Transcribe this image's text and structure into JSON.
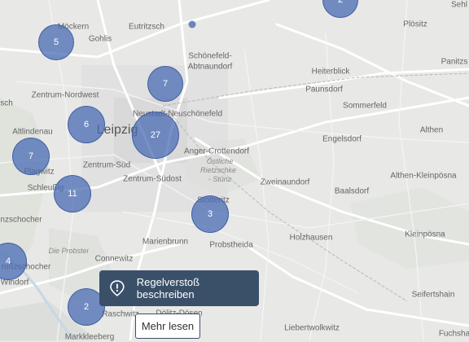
{
  "places": [
    {
      "name": "Sehl"
    },
    {
      "name": "Plösitz"
    },
    {
      "name": "Panitzs"
    },
    {
      "name": "Möckern"
    },
    {
      "name": "Gohlis"
    },
    {
      "name": "Eutritzsch"
    },
    {
      "name": "Schönefeld-"
    },
    {
      "name": "Abtnaundorf"
    },
    {
      "name": "Heiterblick"
    },
    {
      "name": "Paunsdorf"
    },
    {
      "name": "Sommerfeld"
    },
    {
      "name": "Zentrum-Nordwest"
    },
    {
      "name": "sch"
    },
    {
      "name": "Neustadt-Neuschönefeld"
    },
    {
      "name": "Altlindenau"
    },
    {
      "name": "Leipzig"
    },
    {
      "name": "Althen"
    },
    {
      "name": "Engelsdorf"
    },
    {
      "name": "Anger-Crottendorf"
    },
    {
      "name": "Östliche"
    },
    {
      "name": "Rietzschke"
    },
    {
      "name": "- Stünz"
    },
    {
      "name": "Plagwitz"
    },
    {
      "name": "Zentrum-Süd"
    },
    {
      "name": "Zentrum-Südost"
    },
    {
      "name": "Zweinaundorf"
    },
    {
      "name": "Althen-Kleinpösna"
    },
    {
      "name": "Schleußig"
    },
    {
      "name": "Baalsdorf"
    },
    {
      "name": "Stötteritz"
    },
    {
      "name": "nzschocher"
    },
    {
      "name": "Kleinpösna"
    },
    {
      "name": "Marienbrunn"
    },
    {
      "name": "Probstheida"
    },
    {
      "name": "Holzhausen"
    },
    {
      "name": "Die Probstei"
    },
    {
      "name": "roßzschocher"
    },
    {
      "name": "Windorf"
    },
    {
      "name": "Connewitz"
    },
    {
      "name": "Seifertshain"
    },
    {
      "name": "Raschwitz"
    },
    {
      "name": "Dölitz-Dösen"
    },
    {
      "name": "Liebertwolkwitz"
    },
    {
      "name": "Fuchsha"
    },
    {
      "name": "Markkleeberg"
    }
  ],
  "clusters": [
    {
      "count": "2"
    },
    {
      "count": "5"
    },
    {
      "count": "7"
    },
    {
      "count": "6"
    },
    {
      "count": "27"
    },
    {
      "count": "7"
    },
    {
      "count": "11"
    },
    {
      "count": "3"
    },
    {
      "count": "4"
    },
    {
      "count": "2"
    }
  ],
  "report_button": {
    "label": "Regelverstoß beschreiben",
    "icon": "alert-pin-icon"
  },
  "more_button": {
    "label": "Mehr lesen"
  },
  "colors": {
    "cluster": "#4a6cb4",
    "button": "#3a5068",
    "map_bg": "#e8e8e6"
  }
}
